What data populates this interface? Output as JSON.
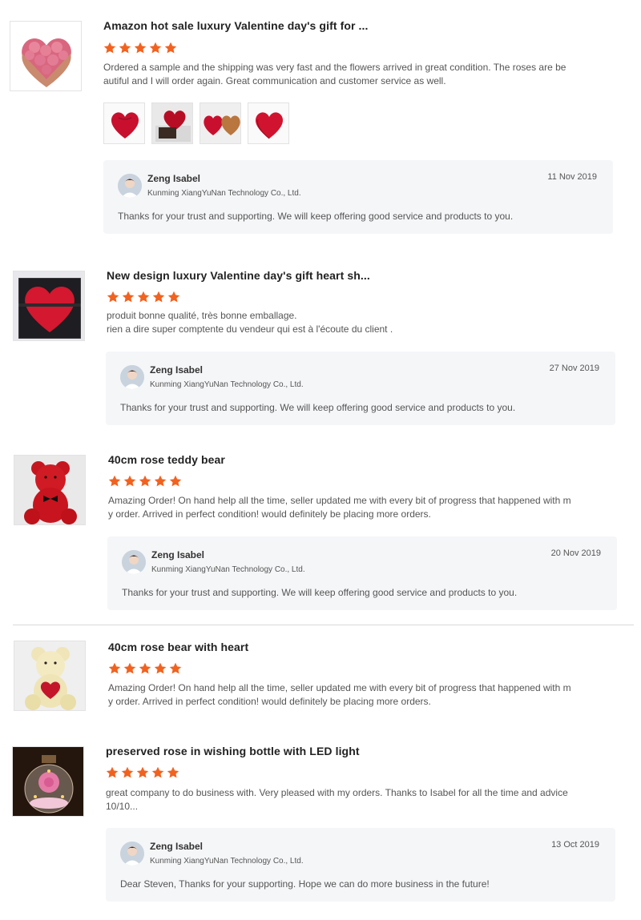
{
  "colors": {
    "star": "#f2621f",
    "reply_bg": "#f5f6f8",
    "divider": "#d9d9d9"
  },
  "icons": {
    "rating": "star-icon"
  },
  "reviews": [
    {
      "title": "Amazon hot sale luxury Valentine day's gift for ...",
      "rating": 5,
      "text": "Ordered a sample and the shipping was very fast and the flowers arrived in great condition. The roses are be\nautiful and I will order again. Great communication and customer service as well.",
      "reply": {
        "name": "Zeng Isabel",
        "company": "Kunming XiangYuNan Technology Co., Ltd.",
        "date": "11 Nov 2019",
        "text": "Thanks for your trust and supporting. We will keep offering good service and products to you."
      }
    },
    {
      "title": "New design luxury Valentine day's gift heart sh...",
      "rating": 5,
      "text": "produit bonne qualité, très bonne emballage.\nrien a dire super comptente du vendeur qui est à l'écoute du client .",
      "reply": {
        "name": "Zeng Isabel",
        "company": "Kunming XiangYuNan Technology Co., Ltd.",
        "date": "27 Nov 2019",
        "text": "Thanks for your trust and supporting. We will keep offering good service and products to you."
      }
    },
    {
      "title": "40cm rose teddy bear",
      "rating": 5,
      "text": "Amazing Order! On hand help all the time, seller updated me with every bit of progress that happened with m\ny order. Arrived in perfect condition! would definitely be placing more orders.",
      "reply": {
        "name": "Zeng Isabel",
        "company": "Kunming XiangYuNan Technology Co., Ltd.",
        "date": "20 Nov 2019",
        "text": "Thanks for your trust and supporting. We will keep offering good service and products to you."
      }
    },
    {
      "title": "40cm rose bear with heart",
      "rating": 5,
      "text": "Amazing Order! On hand help all the time, seller updated me with every bit of progress that happened with m\ny order. Arrived in perfect condition! would definitely be placing more orders."
    },
    {
      "title": "preserved rose in wishing bottle with LED light",
      "rating": 5,
      "text": "great company to do business with. Very pleased with my orders. Thanks to Isabel for all the time and advice\n10/10...",
      "reply": {
        "name": "Zeng Isabel",
        "company": "Kunming XiangYuNan Technology Co., Ltd.",
        "date": "13 Oct 2019",
        "text": "Dear Steven, Thanks for your supporting. Hope we can do more business in the future!"
      }
    }
  ]
}
